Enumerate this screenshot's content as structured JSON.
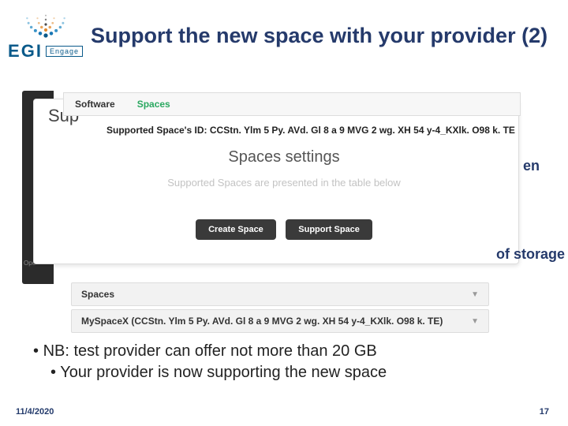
{
  "title": "Support the new space with your provider (2)",
  "logo": {
    "name": "EGI",
    "sub": "Engage"
  },
  "tabs": {
    "software": "Software",
    "spaces": "Spaces"
  },
  "sup_fragment": "Sup",
  "space_id_label": "Supported Space's ID:",
  "space_id_value": "CCStn. Ylm 5 Py. AVd. Gl 8 a 9 MVG 2 wg. XH 54 y-4_KXlk. O98 k. TE",
  "settings_heading": "Spaces settings",
  "settings_desc": "Supported Spaces are presented in the table below",
  "buttons": {
    "create": "Create Space",
    "support": "Support Space"
  },
  "side_fragments": {
    "en": "en",
    "storage": "of storage"
  },
  "dark_label": "Ope",
  "list": {
    "header": "Spaces",
    "item": "MySpaceX (CCStn. Ylm 5 Py. AVd. Gl 8 a 9 MVG 2 wg. XH 54 y-4_KXlk. O98 k. TE)"
  },
  "bullets": {
    "b1": "NB: test provider can offer not more than 20 GB",
    "b2": "Your provider is now supporting the new space"
  },
  "footer": {
    "date": "11/4/2020",
    "page": "17"
  }
}
